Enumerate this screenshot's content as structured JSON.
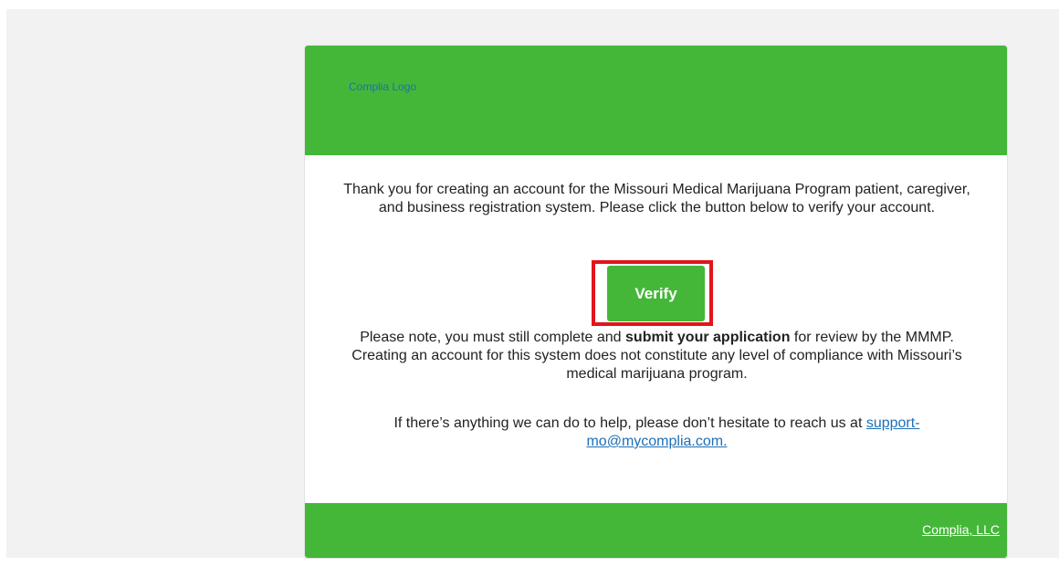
{
  "header": {
    "logo_alt": "Complia Logo"
  },
  "body": {
    "intro": "Thank you for creating an account for the Missouri Medical Marijuana Program patient, caregiver, and business registration system. Please click the button below to verify your account.",
    "verify_label": "Verify",
    "note_prefix": "Please note, you must still complete and ",
    "note_bold": "submit your application",
    "note_suffix": " for review by the MMMP. Creating an account for this system does not constitute any level of compliance with Missouri’s medical marijuana program.",
    "help_prefix": "If there’s anything we can do to help, please don’t hesitate to reach us at ",
    "help_email": "support-mo@mycomplia.com."
  },
  "footer": {
    "company_link": "Complia, LLC"
  },
  "colors": {
    "brand_green": "#44b739",
    "link_blue": "#1d6fb8",
    "highlight_red": "#e3141b"
  }
}
